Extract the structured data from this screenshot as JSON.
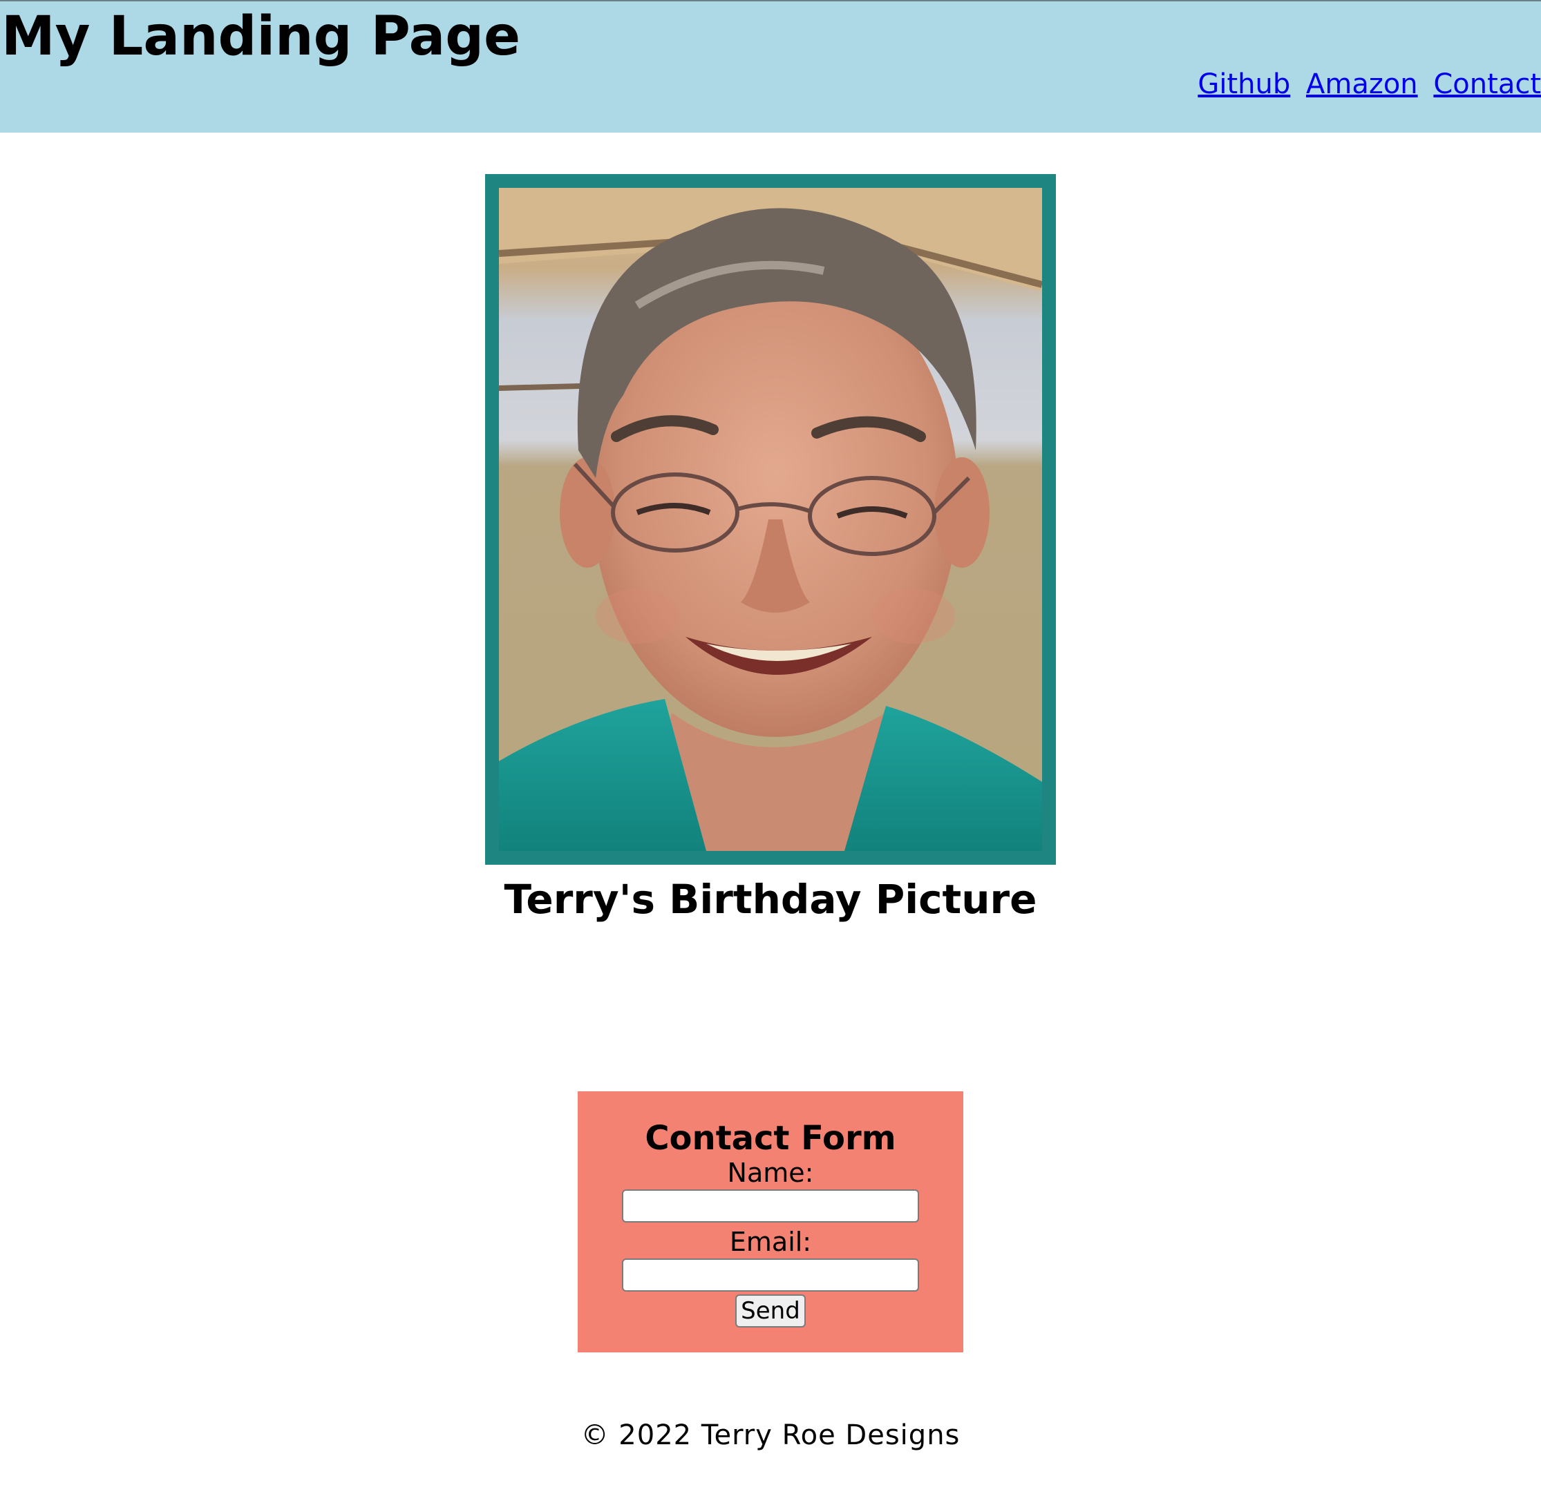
{
  "header": {
    "title": "My Landing Page",
    "links": [
      {
        "label": "Github"
      },
      {
        "label": "Amazon"
      },
      {
        "label": "Contact"
      }
    ]
  },
  "figure": {
    "caption": "Terry's Birthday Picture"
  },
  "contact_form": {
    "title": "Contact Form",
    "name_label": "Name:",
    "name_value": "",
    "email_label": "Email:",
    "email_value": "",
    "send_label": "Send"
  },
  "footer": {
    "text": "© 2022 Terry Roe Designs"
  },
  "colors": {
    "header_bg": "#add8e6",
    "frame": "#1e8580",
    "form_bg": "#f48273",
    "link": "#0000ee"
  }
}
